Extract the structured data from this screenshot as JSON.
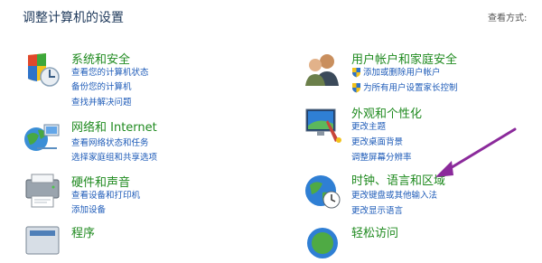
{
  "header": {
    "title": "调整计算机的设置",
    "view_by_label": "查看方式:"
  },
  "categories": [
    {
      "title": "系统和安全",
      "icon": "system-security-icon",
      "links": [
        "查看您的计算机状态",
        "备份您的计算机",
        "查找并解决问题"
      ]
    },
    {
      "title": "网络和 Internet",
      "icon": "network-internet-icon",
      "links": [
        "查看网络状态和任务",
        "选择家庭组和共享选项"
      ]
    },
    {
      "title": "硬件和声音",
      "icon": "hardware-sound-icon",
      "links": [
        "查看设备和打印机",
        "添加设备"
      ]
    },
    {
      "title": "程序",
      "icon": "programs-icon",
      "links": []
    },
    {
      "title": "用户帐户和家庭安全",
      "icon": "user-accounts-icon",
      "links": [
        "添加或删除用户帐户",
        "为所有用户设置家长控制"
      ]
    },
    {
      "title": "外观和个性化",
      "icon": "appearance-icon",
      "links": [
        "更改主题",
        "更改桌面背景",
        "调整屏幕分辨率"
      ]
    },
    {
      "title": "时钟、语言和区域",
      "icon": "clock-language-region-icon",
      "links": [
        "更改键盘或其他输入法",
        "更改显示语言"
      ]
    },
    {
      "title": "轻松访问",
      "icon": "ease-of-access-icon",
      "links": []
    }
  ],
  "colors": {
    "title": "#1e395b",
    "category": "#1f8a1f",
    "link": "#1e5bb8",
    "annotation_arrow": "#8b2a9b"
  }
}
